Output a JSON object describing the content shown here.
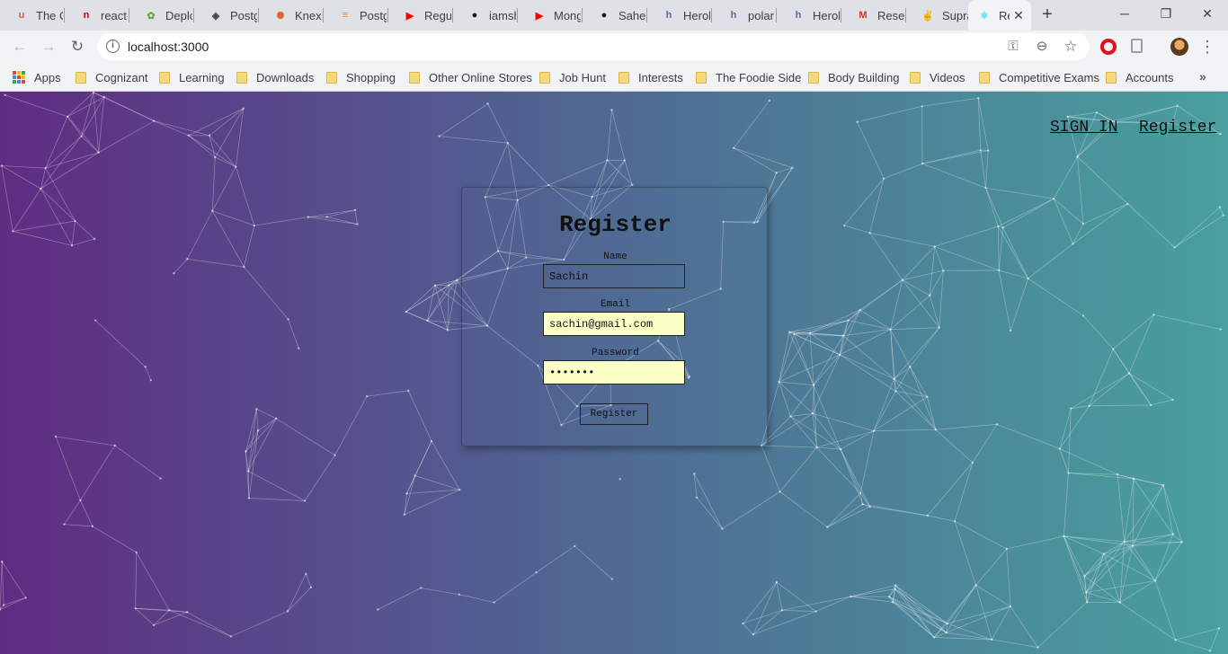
{
  "browser": {
    "tabs": [
      {
        "title": "The C",
        "icon": "udemy-icon",
        "color": "#ec5252",
        "glyph": "u"
      },
      {
        "title": "react-",
        "icon": "npm-icon",
        "color": "#cb0000",
        "glyph": "n"
      },
      {
        "title": "Deplo",
        "icon": "leaf-icon",
        "color": "#6cab3a",
        "glyph": "✿"
      },
      {
        "title": "Postg",
        "icon": "diamond-icon",
        "color": "#444444",
        "glyph": "◈"
      },
      {
        "title": "Knex.j",
        "icon": "gear-icon",
        "color": "#e16426",
        "glyph": "✺"
      },
      {
        "title": "Postg",
        "icon": "stackoverflow-icon",
        "color": "#f48024",
        "glyph": "≡"
      },
      {
        "title": "Regul",
        "icon": "youtube-icon",
        "color": "#ff0000",
        "glyph": "▶"
      },
      {
        "title": "iamsh",
        "icon": "github-icon",
        "color": "#111111",
        "glyph": "●"
      },
      {
        "title": "Mong",
        "icon": "youtube-icon",
        "color": "#ff0000",
        "glyph": "▶"
      },
      {
        "title": "Sahet",
        "icon": "github-icon",
        "color": "#111111",
        "glyph": "●"
      },
      {
        "title": "Herok",
        "icon": "heroku-icon",
        "color": "#79589f",
        "glyph": "h"
      },
      {
        "title": "polar",
        "icon": "heroku-icon",
        "color": "#79589f",
        "glyph": "h"
      },
      {
        "title": "Herok",
        "icon": "heroku-icon",
        "color": "#79589f",
        "glyph": "h"
      },
      {
        "title": "Reset",
        "icon": "gmail-icon",
        "color": "#d93025",
        "glyph": "M"
      },
      {
        "title": "Supra",
        "icon": "peace-icon",
        "color": "#444444",
        "glyph": "✌"
      },
      {
        "title": "Re",
        "icon": "react-icon",
        "color": "#61dafb",
        "glyph": "⚛",
        "active": true
      }
    ],
    "close_glyph": "✕",
    "new_tab_glyph": "+",
    "window": {
      "minimize": "─",
      "restore": "❐",
      "close": "✕"
    },
    "nav": {
      "back": "←",
      "forward": "→",
      "reload": "↻"
    },
    "url": "localhost:3000",
    "info_glyph": "i",
    "omnibox_icons": {
      "key": "⚿",
      "zoom": "⊖",
      "star": "☆"
    },
    "menu_glyph": "⋮",
    "bookmarks": [
      {
        "label": "Apps",
        "type": "apps"
      },
      {
        "label": "Cognizant",
        "type": "folder"
      },
      {
        "label": "Learning",
        "type": "folder"
      },
      {
        "label": "Downloads",
        "type": "folder"
      },
      {
        "label": "Shopping",
        "type": "folder"
      },
      {
        "label": "Other Online Stores",
        "type": "folder"
      },
      {
        "label": "Job Hunt",
        "type": "folder"
      },
      {
        "label": "Interests",
        "type": "folder"
      },
      {
        "label": "The Foodie Side",
        "type": "folder"
      },
      {
        "label": "Body Building",
        "type": "folder"
      },
      {
        "label": "Videos",
        "type": "folder"
      },
      {
        "label": "Competitive Exams",
        "type": "folder"
      },
      {
        "label": "Accounts",
        "type": "folder"
      }
    ],
    "bookmarks_more": "»"
  },
  "app": {
    "nav": {
      "sign_in": "SIGN IN",
      "register": "Register"
    },
    "form": {
      "title": "Register",
      "name_label": "Name",
      "name_value": "Sachin",
      "email_label": "Email",
      "email_value": "sachin@gmail.com",
      "password_label": "Password",
      "password_value": "sachin1",
      "submit_label": "Register"
    }
  },
  "colors": {
    "gradient_start": "#5f2c82",
    "gradient_end": "#49a09d",
    "autofill": "#fbffc6"
  }
}
